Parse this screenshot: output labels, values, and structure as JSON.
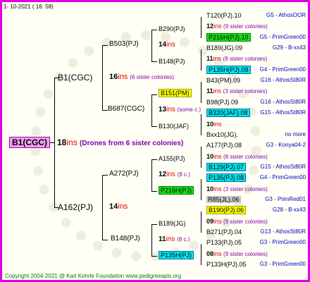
{
  "header": {
    "date": "1-  10-2021  (  16:  58)"
  },
  "root": {
    "id": "B1(CGC)",
    "num": "18",
    "ins": "ins",
    "note": "(Drones from 6 sister colonies)"
  },
  "l2": [
    {
      "id": "B1(CGC)"
    },
    {
      "id": "A162(PJ)"
    }
  ],
  "l3": [
    {
      "id": "B503(PJ)",
      "num": "16",
      "ins": "ins",
      "note": "(6 sister colonies)"
    },
    {
      "id": "B687(CGC)"
    },
    {
      "id": "A272(PJ)",
      "num": "14",
      "ins": "ins"
    },
    {
      "id": "B148(PJ)"
    }
  ],
  "l4": [
    {
      "id": "B290(PJ)",
      "num": "14",
      "ins": "ins"
    },
    {
      "id": "B148(PJ)"
    },
    {
      "id": "B151(PM)",
      "num": "13",
      "ins": "ins",
      "note": "(some c.)"
    },
    {
      "id": "B130(JAF)"
    },
    {
      "id": "A155(PJ)",
      "num": "12",
      "ins": "ins",
      "note": "(9 c.)"
    },
    {
      "id": "P216H(PJ)"
    },
    {
      "id": "B189(JG)",
      "num": "11",
      "ins": "ins",
      "note": "(8 c.)"
    },
    {
      "id": "P135H(PJ)"
    }
  ],
  "l5": [
    {
      "id": "T120(PJ).10",
      "origin": "G5 - AthosOOR"
    },
    {
      "num": "12",
      "ins": "ins",
      "note": "(9 sister colonies)"
    },
    {
      "id": "P216H(PJ).10",
      "hl": "g",
      "origin": "G5 - PrimGreen00"
    },
    {
      "id": "B189(JG).09",
      "origin": "G29 - B-xx43"
    },
    {
      "num": "11",
      "ins": "ins",
      "note": "(8 sister colonies)"
    },
    {
      "id": "P135H(PJ).08",
      "hl": "c",
      "origin": "G4 - PrimGreen00"
    },
    {
      "id": "B43(PM).09",
      "origin": "G16 - AthosSt80R"
    },
    {
      "num": "11",
      "ins": "ins",
      "note": "(3 sister colonies)"
    },
    {
      "id": "B98(PJ).09",
      "origin": "G16 - AthosSt80R"
    },
    {
      "id": "B320(JAF).08",
      "hl": "c",
      "origin": "G15 - AthosSt80R"
    },
    {
      "num": "10",
      "ins": "ins"
    },
    {
      "id": "Bxx10(JG).",
      "origin": "no more"
    },
    {
      "id": "A177(PJ).08",
      "origin": "G3 - Konya04-2"
    },
    {
      "num": "10",
      "ins": "ins",
      "note": "(8 sister colonies)"
    },
    {
      "id": "B129(PJ).07",
      "hl": "c",
      "origin": "G15 - AthosSt80R"
    },
    {
      "id": "P135(PJ).08",
      "hl": "c",
      "origin": "G4 - PrimGreen00"
    },
    {
      "num": "10",
      "ins": "ins",
      "note": "(3 sister colonies)"
    },
    {
      "id": "R85(JL).06",
      "hl": "gr",
      "origin": "G3 - PrimRed01"
    },
    {
      "id": "B190(PJ).06",
      "hl": "y",
      "origin": "G28 - B-xx43"
    },
    {
      "num": "09",
      "ins": "ins",
      "note": "(9 sister colonies)"
    },
    {
      "id": "B271(PJ).04",
      "origin": "G13 - AthosSt80R"
    },
    {
      "id": "P133(PJ).05",
      "origin": "G3 - PrimGreen00"
    },
    {
      "num": "08",
      "ins": "ins",
      "note": "(9 sister colonies)"
    },
    {
      "id": "P133H(PJ).05",
      "origin": "G3 - PrimGreen00"
    }
  ],
  "footer": {
    "copyright": "Copyright 2004-2021 @ Karl Kehrle Foundation     www.pedigreeapis.org"
  }
}
